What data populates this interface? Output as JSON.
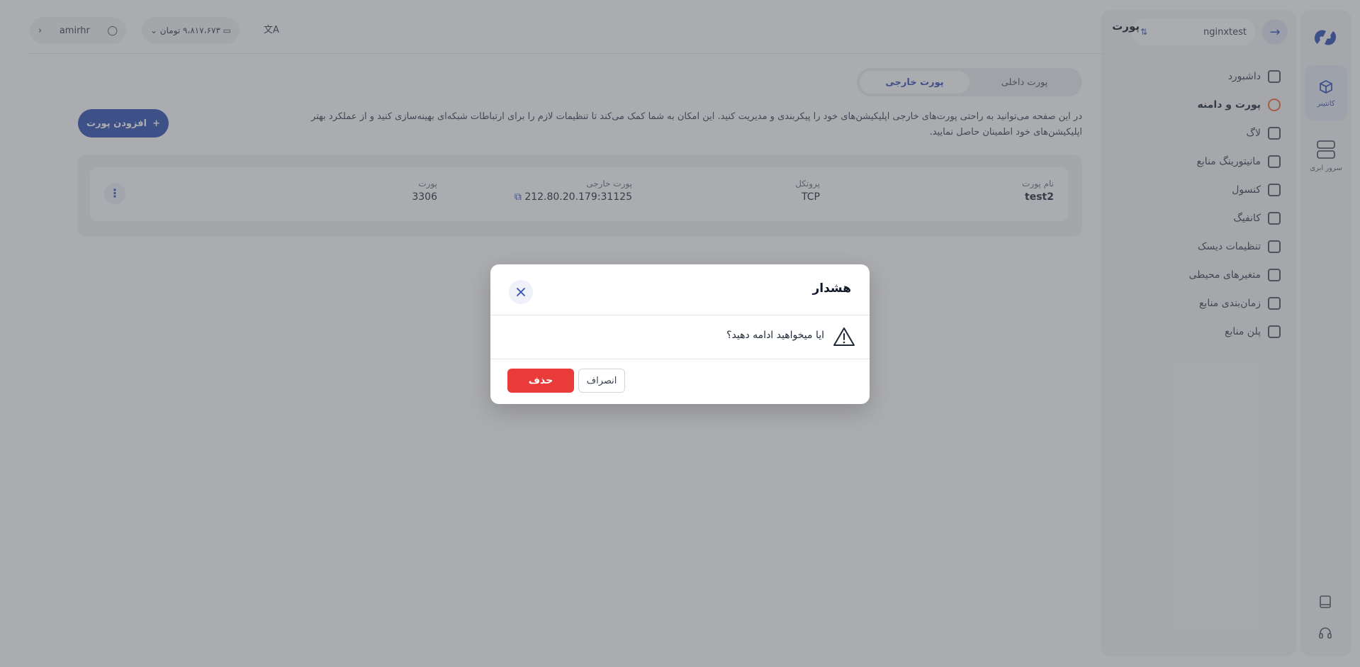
{
  "sidebar": {
    "workspace_value": "nginxtest",
    "items": [
      {
        "label": "داشبورد",
        "icon": "dashboard-icon",
        "active": false
      },
      {
        "label": "پورت و دامنه",
        "icon": "globe-icon",
        "active": true
      },
      {
        "label": "لاگ",
        "icon": "file-icon",
        "active": false
      },
      {
        "label": "مانیتورینگ منابع",
        "icon": "monitor-icon",
        "active": false
      },
      {
        "label": "کنسول",
        "icon": "console-icon",
        "active": false
      },
      {
        "label": "کانفیگ",
        "icon": "settings-icon",
        "active": false
      },
      {
        "label": "تنظیمات دیسک",
        "icon": "disk-icon",
        "active": false
      },
      {
        "label": "متغیرهای محیطی",
        "icon": "variables-icon",
        "active": false
      },
      {
        "label": "زمان‌بندی منابع",
        "icon": "clock-icon",
        "active": false
      },
      {
        "label": "پلن منابع",
        "icon": "plan-icon",
        "active": false
      }
    ]
  },
  "rail": {
    "items": [
      {
        "label": "کانتینر",
        "active": true
      },
      {
        "label": "سرور ابری",
        "active": false
      }
    ]
  },
  "header": {
    "title": "پورت",
    "username": "amirhr",
    "balance": "۹،۸۱۷،۶۷۳ تومان"
  },
  "tabs": [
    {
      "label": "پورت داخلی",
      "active": false
    },
    {
      "label": "پورت خارجی",
      "active": true
    }
  ],
  "description": "در این صفحه می‌توانید به راحتی پورت‌های خارجی اپلیکیشن‌های خود را پیکربندی و مدیریت کنید. این امکان به شما کمک می‌کند تا تنظیمات لازم را برای ارتباطات شبکه‌ای بهینه‌سازی کنید و از عملکرد بهتر اپلیکیشن‌های خود اطمینان حاصل نمایید.",
  "add_button": "افزودن پورت",
  "table": {
    "headers": [
      "نام پورت",
      "پروتکل",
      "پورت خارجی",
      "پورت"
    ],
    "rows": [
      {
        "name": "test2",
        "protocol": "TCP",
        "external": "212.80.20.179:31125",
        "port": "3306"
      }
    ]
  },
  "modal": {
    "title": "هشدار",
    "message": "ایا میخواهید ادامه دهید؟",
    "delete_label": "حذف",
    "cancel_label": "انصراف"
  },
  "colors": {
    "accent": "#2f4fb5",
    "danger": "#ea3b3b",
    "active_nav": "#ef6a3a"
  }
}
